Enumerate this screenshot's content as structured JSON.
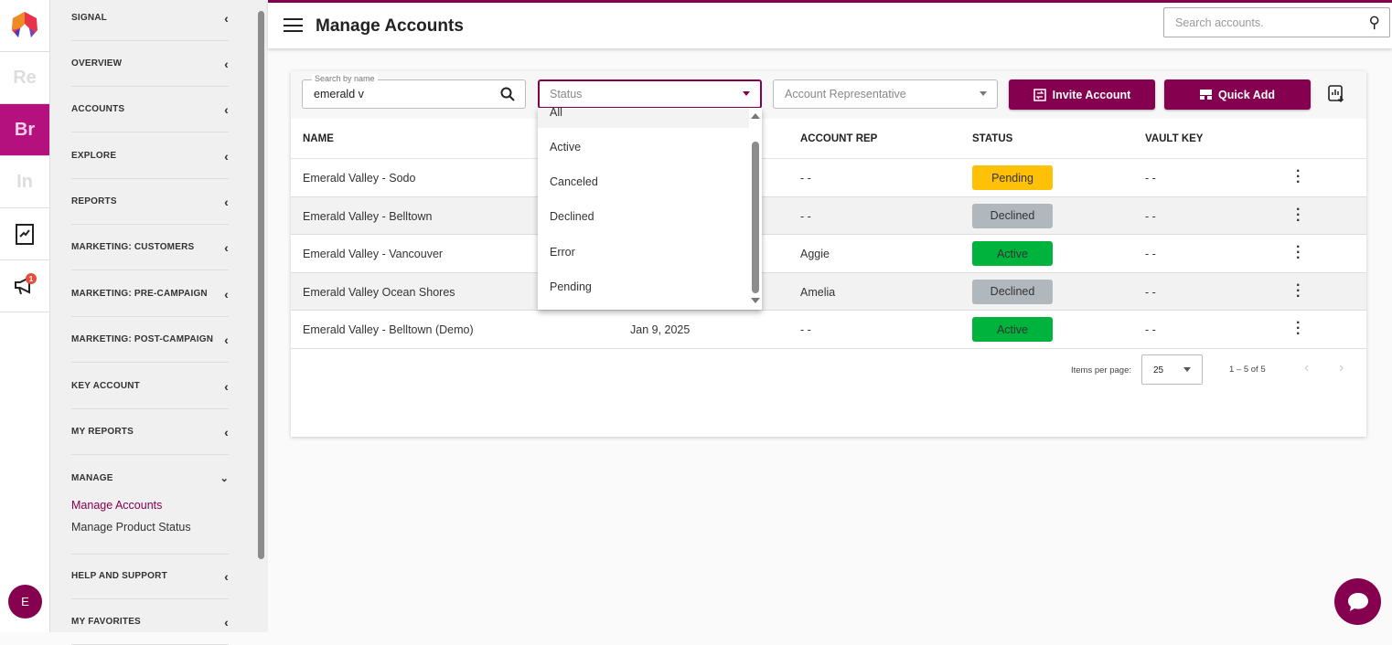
{
  "rail": {
    "items": [
      {
        "label": "Re"
      },
      {
        "label": "Br"
      },
      {
        "label": "In"
      }
    ],
    "notification_count": "1",
    "avatar": "E"
  },
  "sidebar": {
    "items": [
      {
        "label": "SIGNAL"
      },
      {
        "label": "OVERVIEW"
      },
      {
        "label": "ACCOUNTS"
      },
      {
        "label": "EXPLORE"
      },
      {
        "label": "REPORTS"
      },
      {
        "label": "MARKETING: CUSTOMERS"
      },
      {
        "label": "MARKETING: PRE-CAMPAIGN"
      },
      {
        "label": "MARKETING: POST-CAMPAIGN"
      },
      {
        "label": "KEY ACCOUNT"
      },
      {
        "label": "MY REPORTS"
      },
      {
        "label": "MANAGE"
      },
      {
        "label": "HELP AND SUPPORT"
      },
      {
        "label": "MY FAVORITES"
      }
    ],
    "manage_sub": [
      {
        "label": "Manage Accounts"
      },
      {
        "label": "Manage Product Status"
      }
    ]
  },
  "header": {
    "title": "Manage Accounts",
    "search_placeholder": "Search accounts."
  },
  "toolbar": {
    "search_label": "Search by name",
    "search_value": "emerald v",
    "status_placeholder": "Status",
    "rep_placeholder": "Account Representative",
    "invite_label": "Invite Account",
    "quick_add_label": "Quick Add"
  },
  "table": {
    "headers": {
      "name": "NAME",
      "date": "",
      "rep": "ACCOUNT REP",
      "status": "STATUS",
      "vault": "VAULT KEY"
    },
    "rows": [
      {
        "name": "Emerald Valley - Sodo",
        "date": "",
        "rep": "- -",
        "status": "Pending",
        "vault": "- -"
      },
      {
        "name": "Emerald Valley - Belltown",
        "date": "",
        "rep": "- -",
        "status": "Declined",
        "vault": "- -"
      },
      {
        "name": "Emerald Valley - Vancouver",
        "date": "",
        "rep": "Aggie",
        "status": "Active",
        "vault": "- -"
      },
      {
        "name": "Emerald Valley Ocean Shores",
        "date": "",
        "rep": "Amelia",
        "status": "Declined",
        "vault": "- -"
      },
      {
        "name": "Emerald Valley - Belltown (Demo)",
        "date": "Jan 9, 2025",
        "rep": "- -",
        "status": "Active",
        "vault": "- -"
      }
    ]
  },
  "status_colors": {
    "Pending": "#ffc107",
    "Declined": "#b0b7bd",
    "Active": "#00b33c"
  },
  "pagination": {
    "items_per_page_label": "Items per page:",
    "page_size": "25",
    "range": "1 – 5 of 5"
  },
  "status_dropdown": {
    "options": [
      "All",
      "Active",
      "Canceled",
      "Declined",
      "Error",
      "Pending"
    ]
  },
  "accent": "#85004f"
}
